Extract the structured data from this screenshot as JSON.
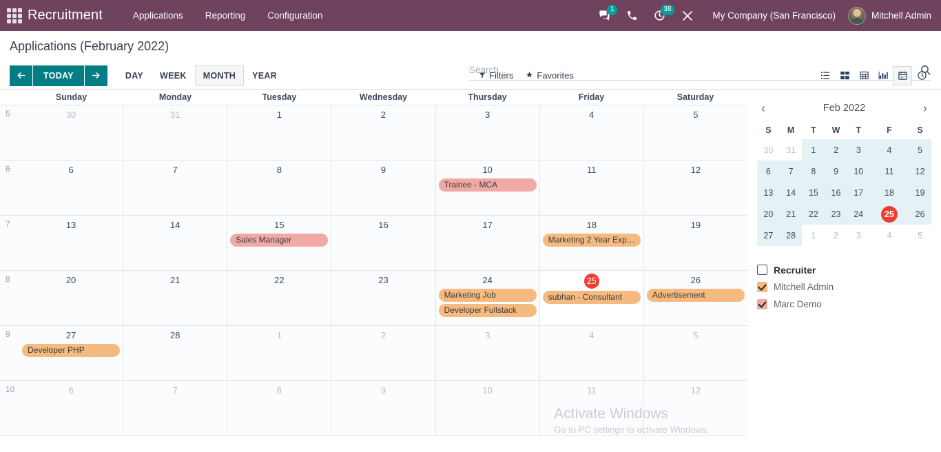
{
  "navbar": {
    "apps_icon": "apps-grid-icon",
    "brand": "Recruitment",
    "menus": [
      {
        "label": "Applications"
      },
      {
        "label": "Reporting"
      },
      {
        "label": "Configuration"
      }
    ],
    "messages_icon": "messages-icon",
    "messages_count": "1",
    "phone_icon": "phone-icon",
    "activities_icon": "activities-clock-icon",
    "activities_count": "38",
    "tools_icon": "tools-icon",
    "company": "My Company (San Francisco)",
    "avatar_icon": "user-avatar",
    "user": "Mitchell Admin"
  },
  "control_panel": {
    "title": "Applications (February 2022)",
    "prev_icon": "arrow-left-icon",
    "next_icon": "arrow-right-icon",
    "today_label": "TODAY",
    "scales": [
      {
        "label": "DAY",
        "active": false
      },
      {
        "label": "WEEK",
        "active": false
      },
      {
        "label": "MONTH",
        "active": true
      },
      {
        "label": "YEAR",
        "active": false
      }
    ],
    "search": {
      "value": "",
      "placeholder": "Search...",
      "icon": "search-icon"
    },
    "filters_label": "Filters",
    "favorites_label": "Favorites",
    "views": [
      {
        "name": "list-view",
        "active": false
      },
      {
        "name": "kanban-view",
        "active": false
      },
      {
        "name": "pivot-view",
        "active": false
      },
      {
        "name": "graph-view",
        "active": false
      },
      {
        "name": "calendar-view",
        "active": true
      },
      {
        "name": "activity-view",
        "active": false
      }
    ]
  },
  "calendar": {
    "day_headers": [
      "Sunday",
      "Monday",
      "Tuesday",
      "Wednesday",
      "Thursday",
      "Friday",
      "Saturday"
    ],
    "weeks": [
      {
        "week_number": "5",
        "days": [
          {
            "num": "30",
            "other": true,
            "today": false,
            "events": []
          },
          {
            "num": "31",
            "other": true,
            "today": false,
            "events": []
          },
          {
            "num": "1",
            "other": false,
            "today": false,
            "events": []
          },
          {
            "num": "2",
            "other": false,
            "today": false,
            "events": []
          },
          {
            "num": "3",
            "other": false,
            "today": false,
            "events": []
          },
          {
            "num": "4",
            "other": false,
            "today": false,
            "events": []
          },
          {
            "num": "5",
            "other": false,
            "today": false,
            "events": []
          }
        ]
      },
      {
        "week_number": "6",
        "days": [
          {
            "num": "6",
            "other": false,
            "today": false,
            "events": []
          },
          {
            "num": "7",
            "other": false,
            "today": false,
            "events": []
          },
          {
            "num": "8",
            "other": false,
            "today": false,
            "events": []
          },
          {
            "num": "9",
            "other": false,
            "today": false,
            "events": []
          },
          {
            "num": "10",
            "other": false,
            "today": false,
            "events": [
              {
                "title": "Trainee - MCA",
                "color": "pink"
              }
            ]
          },
          {
            "num": "11",
            "other": false,
            "today": false,
            "events": []
          },
          {
            "num": "12",
            "other": false,
            "today": false,
            "events": []
          }
        ]
      },
      {
        "week_number": "7",
        "days": [
          {
            "num": "13",
            "other": false,
            "today": false,
            "events": []
          },
          {
            "num": "14",
            "other": false,
            "today": false,
            "events": []
          },
          {
            "num": "15",
            "other": false,
            "today": false,
            "events": [
              {
                "title": "Sales Manager",
                "color": "pink"
              }
            ]
          },
          {
            "num": "16",
            "other": false,
            "today": false,
            "events": []
          },
          {
            "num": "17",
            "other": false,
            "today": false,
            "events": []
          },
          {
            "num": "18",
            "other": false,
            "today": false,
            "events": [
              {
                "title": "Marketing 2 Year Expe...",
                "color": "orange"
              }
            ]
          },
          {
            "num": "19",
            "other": false,
            "today": false,
            "events": []
          }
        ]
      },
      {
        "week_number": "8",
        "days": [
          {
            "num": "20",
            "other": false,
            "today": false,
            "events": []
          },
          {
            "num": "21",
            "other": false,
            "today": false,
            "events": []
          },
          {
            "num": "22",
            "other": false,
            "today": false,
            "events": []
          },
          {
            "num": "23",
            "other": false,
            "today": false,
            "events": []
          },
          {
            "num": "24",
            "other": false,
            "today": false,
            "events": [
              {
                "title": "Marketing Job",
                "color": "orange"
              },
              {
                "title": "Developer Fullstack",
                "color": "orange"
              }
            ]
          },
          {
            "num": "25",
            "other": false,
            "today": true,
            "events": [
              {
                "title": "subhan - Consultant",
                "color": "orange"
              }
            ]
          },
          {
            "num": "26",
            "other": false,
            "today": false,
            "events": [
              {
                "title": "Advertisement",
                "color": "orange"
              }
            ]
          }
        ]
      },
      {
        "week_number": "9",
        "days": [
          {
            "num": "27",
            "other": false,
            "today": false,
            "events": [
              {
                "title": "Developer PHP",
                "color": "orange"
              }
            ]
          },
          {
            "num": "28",
            "other": false,
            "today": false,
            "events": []
          },
          {
            "num": "1",
            "other": true,
            "today": false,
            "events": []
          },
          {
            "num": "2",
            "other": true,
            "today": false,
            "events": []
          },
          {
            "num": "3",
            "other": true,
            "today": false,
            "events": []
          },
          {
            "num": "4",
            "other": true,
            "today": false,
            "events": []
          },
          {
            "num": "5",
            "other": true,
            "today": false,
            "events": []
          }
        ]
      },
      {
        "week_number": "10",
        "days": [
          {
            "num": "6",
            "other": true,
            "today": false,
            "events": []
          },
          {
            "num": "7",
            "other": true,
            "today": false,
            "events": []
          },
          {
            "num": "8",
            "other": true,
            "today": false,
            "events": []
          },
          {
            "num": "9",
            "other": true,
            "today": false,
            "events": []
          },
          {
            "num": "10",
            "other": true,
            "today": false,
            "events": []
          },
          {
            "num": "11",
            "other": true,
            "today": false,
            "events": []
          },
          {
            "num": "12",
            "other": true,
            "today": false,
            "events": []
          }
        ]
      }
    ]
  },
  "sidebar": {
    "mini_calendar": {
      "prev_icon": "chevron-left-icon",
      "next_icon": "chevron-right-icon",
      "title": "Feb 2022",
      "dow": [
        "S",
        "M",
        "T",
        "W",
        "T",
        "F",
        "S"
      ],
      "rows": [
        [
          {
            "n": "30",
            "s": "out"
          },
          {
            "n": "31",
            "s": "out"
          },
          {
            "n": "1",
            "s": "in"
          },
          {
            "n": "2",
            "s": "in"
          },
          {
            "n": "3",
            "s": "in"
          },
          {
            "n": "4",
            "s": "in"
          },
          {
            "n": "5",
            "s": "in"
          }
        ],
        [
          {
            "n": "6",
            "s": "in"
          },
          {
            "n": "7",
            "s": "in"
          },
          {
            "n": "8",
            "s": "in"
          },
          {
            "n": "9",
            "s": "in"
          },
          {
            "n": "10",
            "s": "in"
          },
          {
            "n": "11",
            "s": "in"
          },
          {
            "n": "12",
            "s": "in"
          }
        ],
        [
          {
            "n": "13",
            "s": "in"
          },
          {
            "n": "14",
            "s": "in"
          },
          {
            "n": "15",
            "s": "in"
          },
          {
            "n": "16",
            "s": "in"
          },
          {
            "n": "17",
            "s": "in"
          },
          {
            "n": "18",
            "s": "in"
          },
          {
            "n": "19",
            "s": "in"
          }
        ],
        [
          {
            "n": "20",
            "s": "in"
          },
          {
            "n": "21",
            "s": "in"
          },
          {
            "n": "22",
            "s": "in"
          },
          {
            "n": "23",
            "s": "in"
          },
          {
            "n": "24",
            "s": "in"
          },
          {
            "n": "25",
            "s": "today"
          },
          {
            "n": "26",
            "s": "in"
          }
        ],
        [
          {
            "n": "27",
            "s": "in"
          },
          {
            "n": "28",
            "s": "in"
          },
          {
            "n": "1",
            "s": "out"
          },
          {
            "n": "2",
            "s": "out"
          },
          {
            "n": "3",
            "s": "out"
          },
          {
            "n": "4",
            "s": "out"
          },
          {
            "n": "5",
            "s": "out"
          }
        ]
      ]
    },
    "filters": {
      "header": {
        "label": "Recruiter",
        "checked": false
      },
      "items": [
        {
          "label": "Mitchell Admin",
          "checked": true,
          "color": "#f5ba7f"
        },
        {
          "label": "Marc Demo",
          "checked": true,
          "color": "#f0a9a5"
        }
      ]
    }
  },
  "watermark": {
    "line1": "Activate Windows",
    "line2": "Go to PC settings to activate Windows."
  }
}
